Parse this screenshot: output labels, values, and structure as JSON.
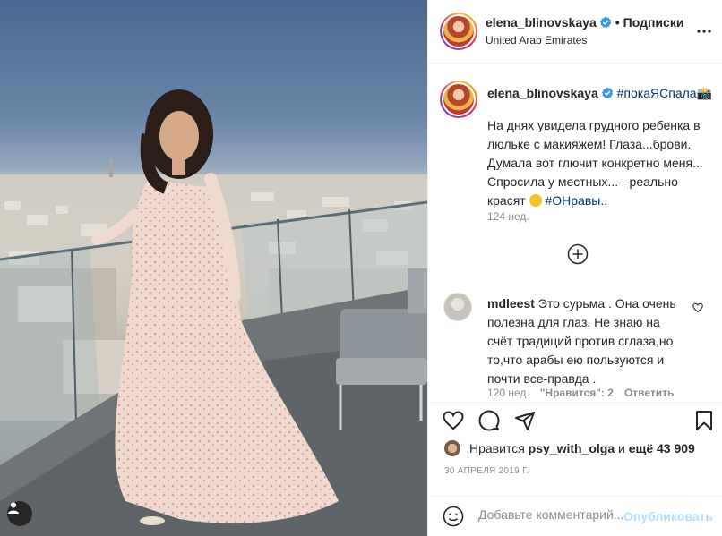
{
  "post": {
    "author": "elena_blinovskaya",
    "separator": "•",
    "follow_label": "Подписки",
    "location": "United Arab Emirates"
  },
  "caption": {
    "author": "elena_blinovskaya",
    "hashtag": "#покаЯСпала📸",
    "text_part1": "На днях увидела грудного ребенка в люльке с макияжем! Глаза...брови. Думала вот глючит конкретно меня... Спросила у местных... - реально красят ",
    "hashtag2": "#ОНравы",
    "text_end": "..",
    "time": "124 нед."
  },
  "comment": {
    "author": "mdleest",
    "text": "Это сурьма . Она очень полезна для глаз. Не знаю на счёт традиций против сглаза,но то,что арабы ею пользуются и почти все-правда .",
    "time": "120 нед.",
    "likes": "\"Нравится\": 2",
    "reply": "Ответить"
  },
  "likes": {
    "prefix": "Нравится",
    "user": "psy_with_olga",
    "mid": "и",
    "others": "ещё 43 909"
  },
  "date": "30 АПРЕЛЯ 2019 Г.",
  "add_comment": {
    "placeholder": "Добавьте комментарий...",
    "publish_label": "Опубликовать"
  },
  "icons": {
    "verified": "verified-badge-icon",
    "more": "more-options-icon",
    "add": "load-more-comments-icon",
    "heart": "heart-icon",
    "comment": "comment-icon",
    "share": "share-icon",
    "bookmark": "bookmark-icon",
    "emoji": "emoji-icon",
    "tag": "user-tag-icon"
  },
  "colors": {
    "verified": "#3897f0",
    "hashtag": "#00376b",
    "publish_disabled": "#b2dffc",
    "secondary_text": "#8e8e8e"
  }
}
